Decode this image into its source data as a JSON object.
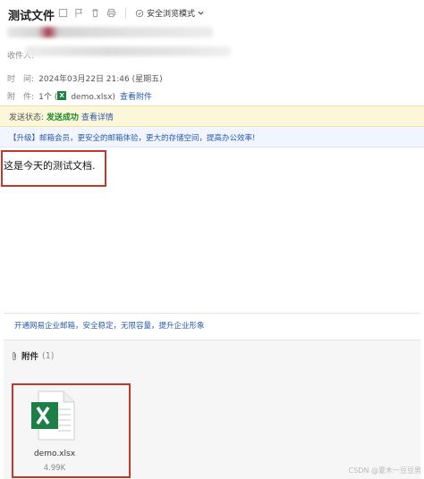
{
  "header": {
    "subject": "测试文件",
    "safe_mode_label": "安全浏览模式",
    "to_label": "收件人:",
    "time_label": "时　间:",
    "time_value": "2024年03月22日 21:46 (星期五)",
    "attach_label": "附　件:",
    "attach_count_prefix": "1个 (",
    "attach_file": "demo.xlsx",
    "attach_count_suffix": ")",
    "view_attach_link": "查看附件"
  },
  "status": {
    "label": "发送状态:",
    "value": "发送成功",
    "detail_link": "查看详情"
  },
  "upgrade_banner": "【升级】邮箱会员，更安全的邮箱体验，更大的存储空间，提高办公效率!",
  "body": {
    "text": "这是今天的测试文档."
  },
  "promo": "开通网易企业邮箱，安全稳定，无限容量，提升企业形象",
  "attachments": {
    "title": "附件",
    "count": "(1)",
    "items": [
      {
        "name": "demo.xlsx",
        "size": "4.99K",
        "icon": "excel-file-icon"
      }
    ]
  },
  "watermark": "CSDN @夏木一豆豆男",
  "colors": {
    "status_ok": "#1c8a2c",
    "link": "#2b5aa8",
    "highlight_box": "#c0392b",
    "excel_green": "#1d7f45"
  }
}
